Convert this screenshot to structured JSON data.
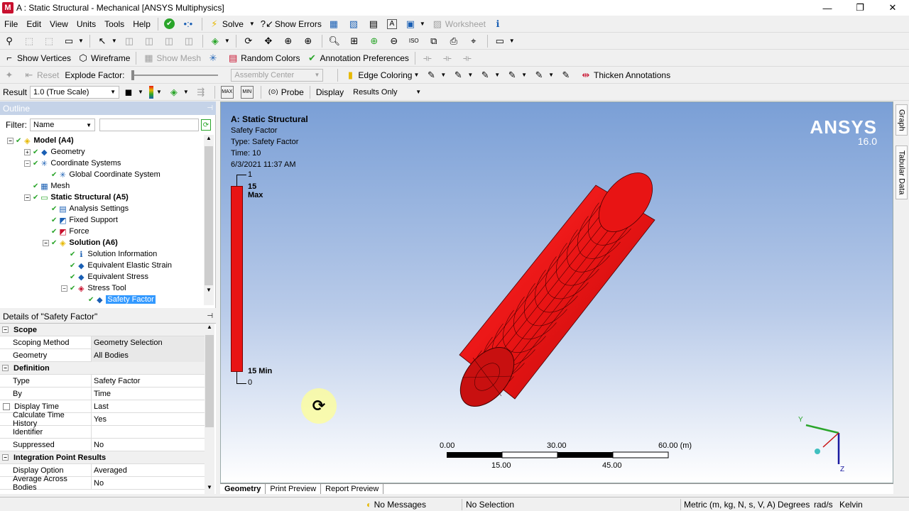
{
  "window": {
    "title": "A : Static Structural - Mechanical [ANSYS Multiphysics]",
    "app_icon": "M"
  },
  "menu": [
    "File",
    "Edit",
    "View",
    "Units",
    "Tools",
    "Help"
  ],
  "toolbar1": {
    "solve": "Solve",
    "show_errors": "Show Errors",
    "worksheet": "Worksheet"
  },
  "toolbar3": {
    "show_vertices": "Show Vertices",
    "wireframe": "Wireframe",
    "show_mesh": "Show Mesh",
    "random_colors": "Random Colors",
    "annotation_prefs": "Annotation Preferences"
  },
  "toolbar4": {
    "reset": "Reset",
    "explode_factor": "Explode Factor:",
    "assembly_center": "Assembly Center",
    "edge_coloring": "Edge Coloring",
    "thicken_annotations": "Thicken Annotations"
  },
  "toolbar5": {
    "result_label": "Result",
    "scale": "1.0 (True Scale)",
    "probe": "Probe",
    "display_label": "Display",
    "display_value": "Results Only"
  },
  "outline": {
    "header": "Outline",
    "filter_label": "Filter:",
    "filter_value": "Name",
    "items": [
      {
        "label": "Model (A4)"
      },
      {
        "label": "Geometry"
      },
      {
        "label": "Coordinate Systems"
      },
      {
        "label": "Global Coordinate System"
      },
      {
        "label": "Mesh"
      },
      {
        "label": "Static Structural (A5)"
      },
      {
        "label": "Analysis Settings"
      },
      {
        "label": "Fixed Support"
      },
      {
        "label": "Force"
      },
      {
        "label": "Solution (A6)"
      },
      {
        "label": "Solution Information"
      },
      {
        "label": "Equivalent Elastic Strain"
      },
      {
        "label": "Equivalent Stress"
      },
      {
        "label": "Stress Tool"
      },
      {
        "label": "Safety Factor"
      }
    ]
  },
  "details": {
    "header": "Details of \"Safety Factor\"",
    "rows": [
      {
        "k": "Scope",
        "cat": true
      },
      {
        "k": "Scoping Method",
        "v": "Geometry Selection"
      },
      {
        "k": "Geometry",
        "v": "All Bodies"
      },
      {
        "k": "Definition",
        "cat": true
      },
      {
        "k": "Type",
        "v": "Safety Factor"
      },
      {
        "k": "By",
        "v": "Time"
      },
      {
        "k": "Display Time",
        "v": "Last"
      },
      {
        "k": "Calculate Time History",
        "v": "Yes"
      },
      {
        "k": "Identifier",
        "v": ""
      },
      {
        "k": "Suppressed",
        "v": "No"
      },
      {
        "k": "Integration Point Results",
        "cat": true
      },
      {
        "k": "Display Option",
        "v": "Averaged"
      },
      {
        "k": "Average Across Bodies",
        "v": "No"
      }
    ]
  },
  "viewport": {
    "analysis": "A: Static Structural",
    "result": "Safety Factor",
    "type": "Type: Safety Factor",
    "time": "Time: 10",
    "date": "6/3/2021 11:37 AM",
    "legend_top": "1",
    "legend_max": "15 Max",
    "legend_min": "15 Min",
    "legend_bottom": "0",
    "brand": "ANSYS",
    "version": "16.0",
    "scale_labels_top": [
      "0.00",
      "30.00",
      "60.00 (m)"
    ],
    "scale_labels_bottom": [
      "15.00",
      "45.00"
    ],
    "axes": {
      "y": "Y",
      "z": "Z"
    }
  },
  "tabs": [
    "Geometry",
    "Print Preview",
    "Report Preview"
  ],
  "side_tabs": [
    "Graph",
    "Tabular Data"
  ],
  "status": {
    "messages": "No Messages",
    "selection": "No Selection",
    "units": "Metric (m, kg, N, s, V, A)",
    "angle": "Degrees",
    "rate": "rad/s",
    "temp": "Kelvin"
  },
  "colors": {
    "result": "#e81414",
    "accent": "#3399ff"
  }
}
